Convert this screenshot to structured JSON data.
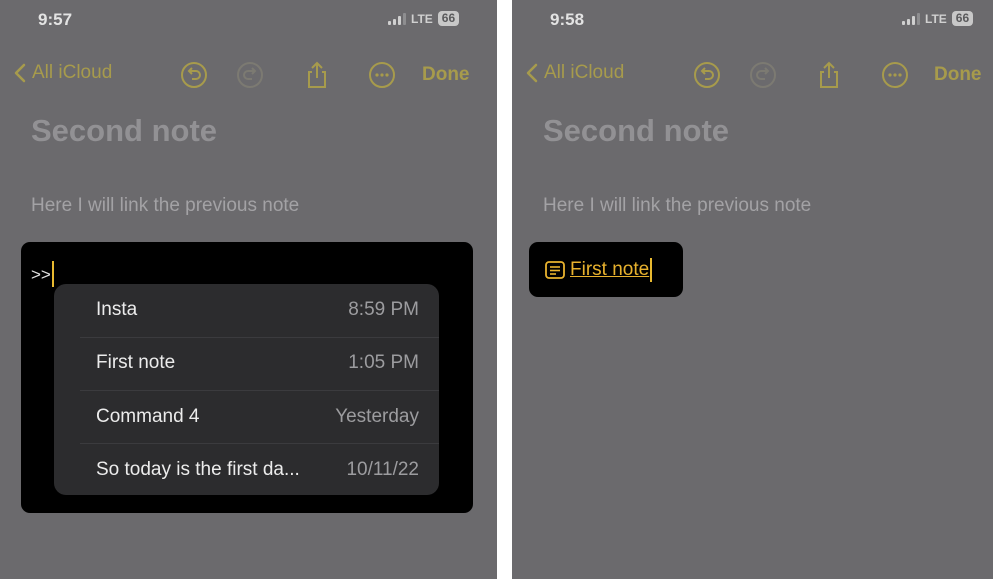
{
  "left": {
    "status": {
      "time": "9:57",
      "network": "LTE",
      "battery": "66"
    },
    "toolbar": {
      "back_label": "All iCloud",
      "done_label": "Done"
    },
    "note": {
      "title": "Second note",
      "body": "Here I will link the previous note"
    },
    "typed_text": ">>",
    "suggestions": [
      {
        "name": "Insta",
        "time": "8:59 PM"
      },
      {
        "name": "First note",
        "time": "1:05 PM"
      },
      {
        "name": "Command 4",
        "time": "Yesterday"
      },
      {
        "name": "So today is the first da...",
        "time": "10/11/22"
      }
    ]
  },
  "right": {
    "status": {
      "time": "9:58",
      "network": "LTE",
      "battery": "66"
    },
    "toolbar": {
      "back_label": "All iCloud",
      "done_label": "Done"
    },
    "note": {
      "title": "Second note",
      "body": "Here I will link the previous note"
    },
    "link": {
      "label": "First note",
      "icon": "note-icon"
    }
  },
  "colors": {
    "accent": "#a79b4c",
    "link": "#e8b22e",
    "background": "#6b6a6d",
    "menu": "#2c2c2e"
  },
  "icons": [
    "chevron-left-icon",
    "undo-icon",
    "redo-icon",
    "share-icon",
    "more-icon",
    "note-icon"
  ]
}
